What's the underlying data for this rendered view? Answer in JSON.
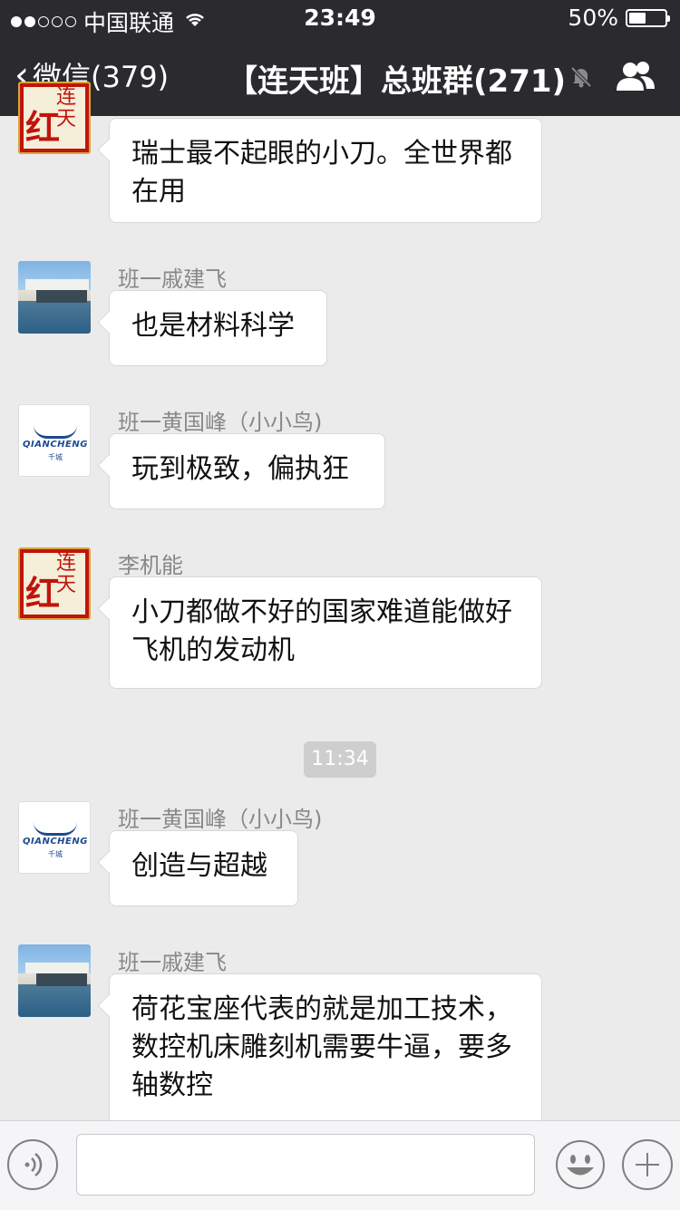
{
  "status_bar": {
    "carrier": "中国联通",
    "time": "23:49",
    "battery": "50%",
    "signal_bars_filled": 2,
    "signal_bars_total": 5
  },
  "nav": {
    "back_label": "微信(379)",
    "title": "【连天班】总班群(271)",
    "mute_icon": "bell-slash-icon",
    "members_icon": "group-members-icon"
  },
  "messages": [
    {
      "sender": "",
      "avatar": "red-calligraphy-avatar",
      "text": "瑞士最不起眼的小刀。全世界都在用"
    },
    {
      "sender": "班一戚建飞",
      "avatar": "modern-house-avatar",
      "text": "也是材料科学"
    },
    {
      "sender": "班一黄国峰（小小鸟)",
      "avatar": "qiancheng-logo-avatar",
      "text": "玩到极致，偏执狂"
    },
    {
      "sender": "李机能",
      "avatar": "red-calligraphy-avatar",
      "text": "小刀都做不好的国家难道能做好飞机的发动机"
    },
    {
      "sender": "班一黄国峰（小小鸟)",
      "avatar": "qiancheng-logo-avatar",
      "text": "创造与超越"
    },
    {
      "sender": "班一戚建飞",
      "avatar": "modern-house-avatar",
      "text": "荷花宝座代表的就是加工技术，数控机床雕刻机需要牛逼，要多轴数控"
    }
  ],
  "timestamp": "11:34",
  "avatar_text": {
    "red": "红",
    "red_small": "连天",
    "logo": "QIANCHENG",
    "logo_sub": "千城"
  },
  "input_bar": {
    "voice_icon": "voice-input-icon",
    "emoji_icon": "emoji-icon",
    "plus_icon": "plus-icon",
    "text_value": ""
  }
}
